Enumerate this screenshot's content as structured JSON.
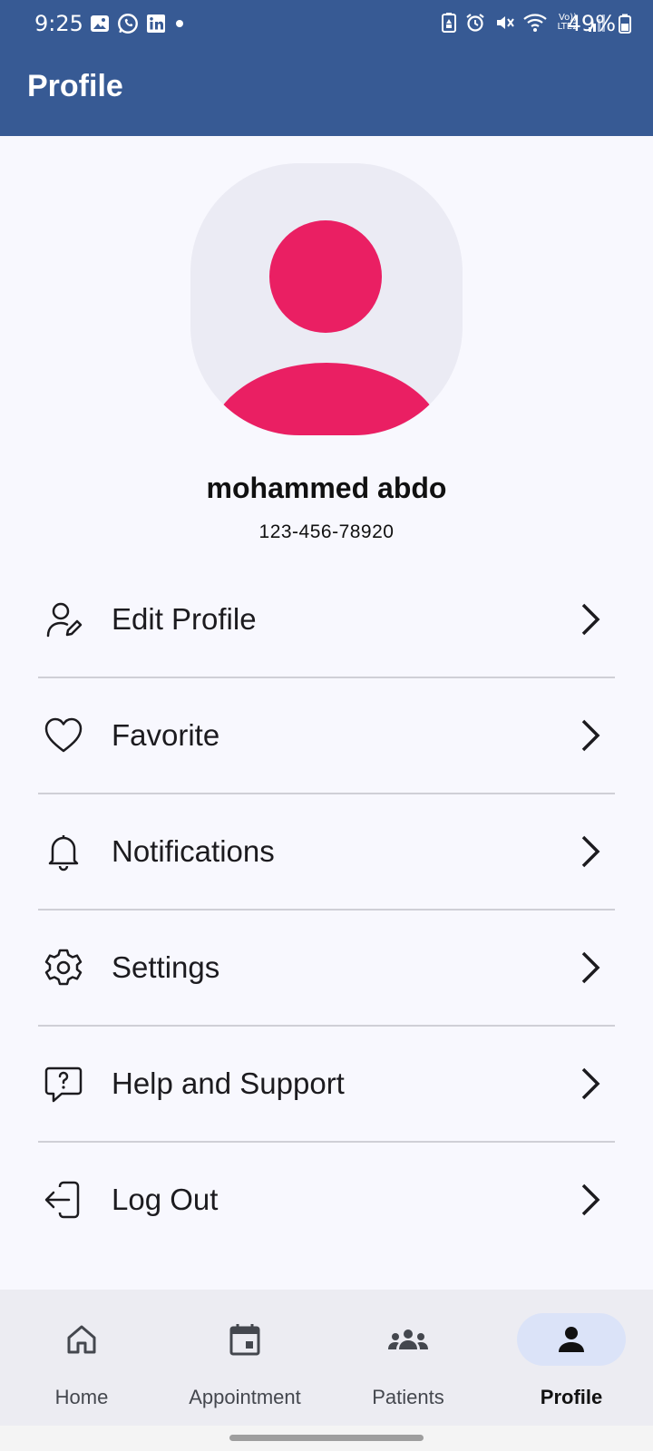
{
  "status_bar": {
    "time": "9:25",
    "battery": "49%",
    "left_icons": [
      "gallery-icon",
      "whatsapp-icon",
      "linkedin-icon",
      "dot-icon"
    ],
    "right_icons": [
      "battery-saver-icon",
      "alarm-icon",
      "mute-icon",
      "wifi-icon",
      "volte-icon",
      "signal-icon"
    ],
    "volte_text": "Vo)) LTE2"
  },
  "app_bar": {
    "title": "Profile"
  },
  "profile": {
    "name": "mohammed abdo",
    "phone": "123-456-78920",
    "avatar_color": "#ea1f63",
    "avatar_bg": "#ebebf4"
  },
  "menu": [
    {
      "label": "Edit Profile",
      "icon": "user-edit-icon"
    },
    {
      "label": "Favorite",
      "icon": "heart-icon"
    },
    {
      "label": "Notifications",
      "icon": "bell-icon"
    },
    {
      "label": "Settings",
      "icon": "gear-icon"
    },
    {
      "label": "Help and Support",
      "icon": "help-chat-icon"
    },
    {
      "label": "Log Out",
      "icon": "logout-icon"
    }
  ],
  "bottom_nav": {
    "items": [
      {
        "label": "Home",
        "icon": "home-icon"
      },
      {
        "label": "Appointment",
        "icon": "calendar-icon"
      },
      {
        "label": "Patients",
        "icon": "group-icon"
      },
      {
        "label": "Profile",
        "icon": "person-icon",
        "active": true
      }
    ]
  },
  "colors": {
    "primary": "#375a94",
    "background": "#f8f8fe",
    "nav_background": "#ececf2",
    "active_pill": "#dbe3f8"
  }
}
